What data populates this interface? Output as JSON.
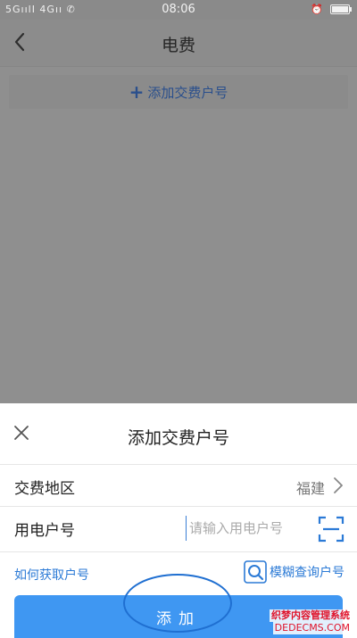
{
  "status_bar": {
    "left": "5GıılI 4Gıı ✆",
    "time": "08:06",
    "alarm_icon": "alarm-icon",
    "battery_icon": "battery-icon"
  },
  "page": {
    "title": "电费",
    "back_icon": "back-arrow-icon",
    "add_account_label": "添加交费户号"
  },
  "sheet": {
    "title": "添加交费户号",
    "close_icon": "close-icon",
    "region": {
      "label": "交费地区",
      "value": "福建"
    },
    "account": {
      "label": "用电户号",
      "placeholder": "请输入用电户号",
      "value": ""
    },
    "how_to_link": "如何获取户号",
    "fuzzy_search_label": "模糊查询户号",
    "add_button_label": "添加"
  },
  "watermark": {
    "line1": "织梦内容管理系统",
    "line2": "DEDECMS.COM"
  },
  "colors": {
    "accent": "#2b7ad6",
    "button": "#3f97f2",
    "overlay": "#8f8f8f"
  }
}
